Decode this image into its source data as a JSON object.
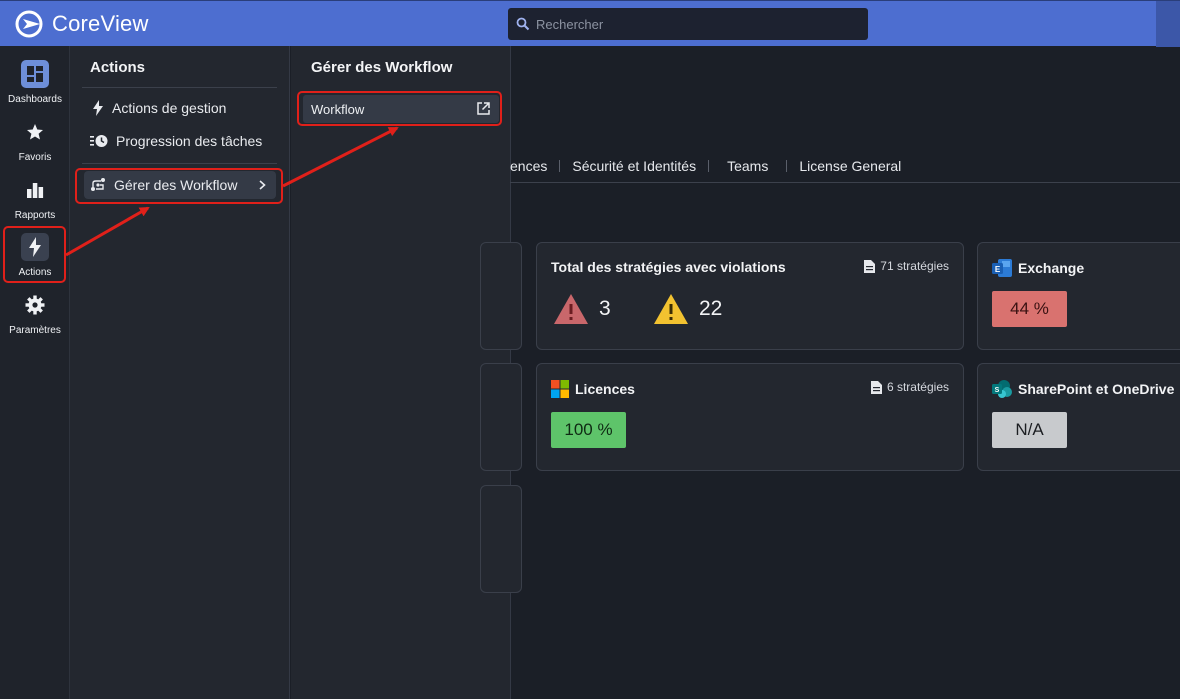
{
  "app": {
    "name": "CoreView",
    "brand_color": "#4d6ed0"
  },
  "search": {
    "placeholder": "Rechercher"
  },
  "rail": {
    "items": [
      {
        "label": "Dashboards",
        "icon": "dashboard-icon"
      },
      {
        "label": "Favoris",
        "icon": "star-icon"
      },
      {
        "label": "Rapports",
        "icon": "bar-chart-icon"
      },
      {
        "label": "Actions",
        "icon": "lightning-icon"
      },
      {
        "label": "Paramètres",
        "icon": "gear-icon"
      }
    ],
    "active": "Actions"
  },
  "actions_panel": {
    "title": "Actions",
    "items": [
      {
        "label": "Actions de gestion",
        "icon": "lightning-icon"
      },
      {
        "label": "Progression des tâches",
        "icon": "clock-list-icon"
      },
      {
        "label": "Gérer des Workflow",
        "icon": "workflow-icon",
        "selected": true
      }
    ]
  },
  "workflow_panel": {
    "title": "Gérer des Workflow",
    "items": [
      {
        "label": "Workflow",
        "icon": "external-link-icon"
      }
    ]
  },
  "tabs": [
    "ences",
    "Sécurité et Identités",
    "Teams",
    "License General"
  ],
  "cards": {
    "violations": {
      "title": "Total des stratégies avec violations",
      "meta": "71 stratégies",
      "critical_count": "3",
      "warning_count": "22"
    },
    "exchange": {
      "title": "Exchange",
      "value": "44 %",
      "color": "#d9726f"
    },
    "licences": {
      "title": "Licences",
      "meta": "6 stratégies",
      "value": "100 %",
      "color": "#5ec46a"
    },
    "sharepoint": {
      "title": "SharePoint et OneDrive",
      "value": "N/A",
      "color": "#c8cacd"
    }
  },
  "annotation_color": "#e0201a"
}
